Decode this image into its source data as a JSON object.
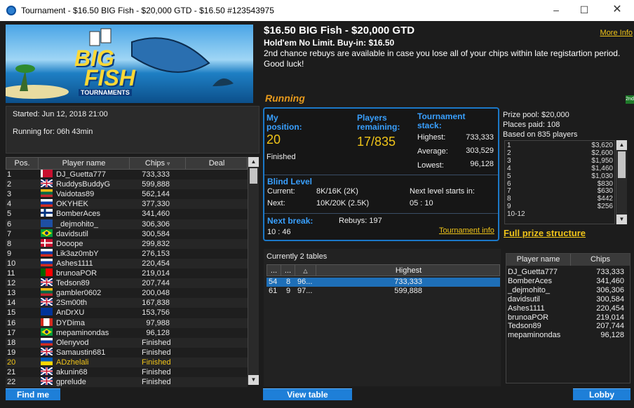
{
  "window": {
    "title": "Tournament - $16.50 BIG Fish - $20,000 GTD - $16.50 #123543975"
  },
  "banner": {
    "line1": "BIG",
    "line2": "FISH",
    "line3": "TOURNAMENTS"
  },
  "info": {
    "started": "Started: Jun 12, 2018 21:00",
    "running": "Running for: 06h 43min"
  },
  "players": {
    "headers": {
      "pos": "Pos.",
      "name": "Player name",
      "chips": "Chips",
      "deal": "Deal"
    },
    "rows": [
      {
        "pos": "1",
        "flag": "by",
        "name": "DJ_Guetta777",
        "chips": "733,333"
      },
      {
        "pos": "2",
        "flag": "gb",
        "name": "RuddysBuddyG",
        "chips": "599,888"
      },
      {
        "pos": "3",
        "flag": "lt",
        "name": "Vaidotas89",
        "chips": "562,144"
      },
      {
        "pos": "4",
        "flag": "ru",
        "name": "OKYHEK",
        "chips": "377,330"
      },
      {
        "pos": "5",
        "flag": "fi",
        "name": "BomberAces",
        "chips": "341,460"
      },
      {
        "pos": "6",
        "flag": "xx",
        "name": "_dejmohito_",
        "chips": "306,306"
      },
      {
        "pos": "7",
        "flag": "br",
        "name": "davidsutil",
        "chips": "300,584"
      },
      {
        "pos": "8",
        "flag": "dk",
        "name": "Dooope",
        "chips": "299,832"
      },
      {
        "pos": "9",
        "flag": "ru",
        "name": "Lik3az0mbY",
        "chips": "276,153"
      },
      {
        "pos": "10",
        "flag": "ru",
        "name": "Ashes1111",
        "chips": "220,454"
      },
      {
        "pos": "11",
        "flag": "pt",
        "name": "brunoaPOR",
        "chips": "219,014"
      },
      {
        "pos": "12",
        "flag": "gb",
        "name": "Tedson89",
        "chips": "207,744"
      },
      {
        "pos": "13",
        "flag": "lt",
        "name": "gambler0602",
        "chips": "200,048"
      },
      {
        "pos": "14",
        "flag": "gb",
        "name": "2Sm00th",
        "chips": "167,838"
      },
      {
        "pos": "15",
        "flag": "eu",
        "name": "AnDrXU",
        "chips": "153,756"
      },
      {
        "pos": "16",
        "flag": "ca",
        "name": "DYDima",
        "chips": "97,988"
      },
      {
        "pos": "17",
        "flag": "br",
        "name": "mepaminondas",
        "chips": "96,128"
      },
      {
        "pos": "18",
        "flag": "ru",
        "name": "Olenyvod",
        "chips": "Finished"
      },
      {
        "pos": "19",
        "flag": "gb",
        "name": "Samaustin681",
        "chips": "Finished"
      },
      {
        "pos": "20",
        "flag": "ua",
        "name": "ADzhelali",
        "chips": "Finished",
        "highlight": true
      },
      {
        "pos": "21",
        "flag": "gb",
        "name": "akunin68",
        "chips": "Finished"
      },
      {
        "pos": "22",
        "flag": "gb",
        "name": "gprelude",
        "chips": "Finished"
      }
    ]
  },
  "tournament": {
    "name": "$16.50 BIG Fish - $20,000 GTD",
    "type": "Hold'em No Limit. Buy-in: $16.50",
    "description": "2nd chance rebuys are available in case you lose all of your chips within late registartion period. Good luck!",
    "more_info": "More Info",
    "status": "Running",
    "badge": "2nd"
  },
  "stats": {
    "my_position_label": "My position:",
    "my_position": "20",
    "my_status": "Finished",
    "players_remaining_label": "Players remaining:",
    "players_remaining": "17/835",
    "stack_label": "Tournament stack:",
    "highest_label": "Highest:",
    "highest": "733,333",
    "average_label": "Average:",
    "average": "303,529",
    "lowest_label": "Lowest:",
    "lowest": "96,128",
    "blind_label": "Blind Level",
    "current_label": "Current:",
    "current": "8K/16K (2K)",
    "next_label": "Next:",
    "next": "10K/20K (2.5K)",
    "next_level_label": "Next level starts in:",
    "next_level": "05 : 10",
    "next_break_label": "Next break:",
    "next_break": "10 : 46",
    "rebuys": "Rebuys: 197",
    "tournament_info": "Tournament info"
  },
  "prize": {
    "pool": "Prize pool: $20,000",
    "places": "Places paid: 108",
    "based": "Based on 835 players",
    "rows": [
      {
        "place": "1",
        "amount": "$3,620"
      },
      {
        "place": "2",
        "amount": "$2,600"
      },
      {
        "place": "3",
        "amount": "$1,950"
      },
      {
        "place": "4",
        "amount": "$1,460"
      },
      {
        "place": "5",
        "amount": "$1,030"
      },
      {
        "place": "6",
        "amount": "$830"
      },
      {
        "place": "7",
        "amount": "$630"
      },
      {
        "place": "8",
        "amount": "$442"
      },
      {
        "place": "9",
        "amount": "$256"
      },
      {
        "place": "10-12",
        "amount": ""
      }
    ],
    "full": "Full prize structure"
  },
  "tables": {
    "caption": "Currently 2 tables",
    "headers": {
      "c1": "...",
      "c2": "...",
      "c3": "",
      "c4": "Highest"
    },
    "rows": [
      {
        "a": "54",
        "b": "8",
        "c": "96...",
        "high": "733,333",
        "selected": true
      },
      {
        "a": "61",
        "b": "9",
        "c": "97...",
        "high": "599,888",
        "selected": false
      }
    ]
  },
  "table_players": {
    "headers": {
      "name": "Player name",
      "chips": "Chips"
    },
    "rows": [
      {
        "name": "DJ_Guetta777",
        "chips": "733,333"
      },
      {
        "name": "BomberAces",
        "chips": "341,460"
      },
      {
        "name": "_dejmohito_",
        "chips": "306,306"
      },
      {
        "name": "davidsutil",
        "chips": "300,584"
      },
      {
        "name": "Ashes1111",
        "chips": "220,454"
      },
      {
        "name": "brunoaPOR",
        "chips": "219,014"
      },
      {
        "name": "Tedson89",
        "chips": "207,744"
      },
      {
        "name": "mepaminondas",
        "chips": "96,128"
      }
    ]
  },
  "buttons": {
    "find_me": "Find me",
    "view_table": "View table",
    "lobby": "Lobby"
  },
  "colors": {
    "accent": "#f0c419",
    "blue": "#1b78c8",
    "running": "#e79a1c"
  }
}
